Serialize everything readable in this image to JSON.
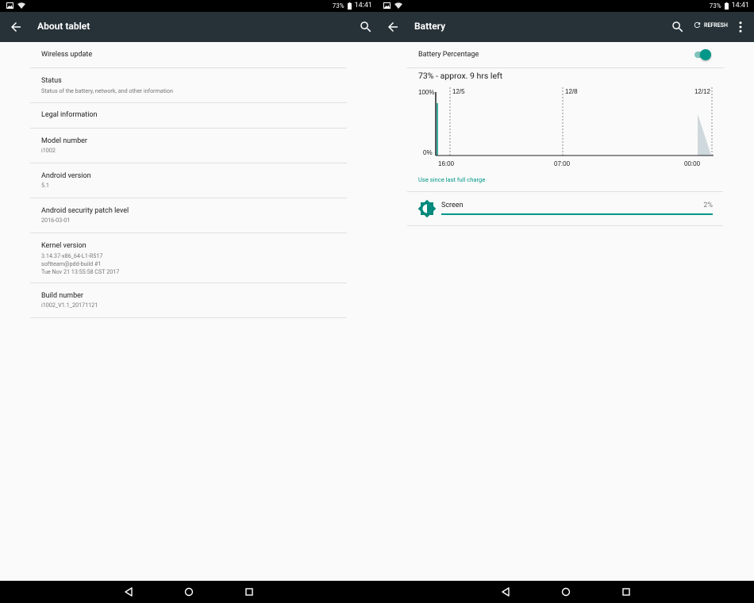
{
  "status_bar": {
    "battery": "73%",
    "time": "14:41"
  },
  "about": {
    "title": "About tablet",
    "items": [
      {
        "label": "Wireless update",
        "sub": []
      },
      {
        "label": "Status",
        "sub": [
          "Status of the battery, network, and other information"
        ]
      },
      {
        "label": "Legal information",
        "sub": []
      },
      {
        "label": "Model number",
        "sub": [
          "i1002"
        ]
      },
      {
        "label": "Android version",
        "sub": [
          "5.1"
        ]
      },
      {
        "label": "Android security patch level",
        "sub": [
          "2016-03-01"
        ]
      },
      {
        "label": "Kernel version",
        "sub": [
          "3.14.37-x86_64-L1-R517",
          "softteam@pdd-build #1",
          "Tue Nov 21 13:55:58 CST 2017"
        ]
      },
      {
        "label": "Build number",
        "sub": [
          "i1002_V1.1_20171121"
        ]
      }
    ]
  },
  "battery": {
    "title": "Battery",
    "refresh_label": "REFRESH",
    "percentage_label": "Battery Percentage",
    "percentage_toggle_on": true,
    "summary": "73% - approx. 9 hrs left",
    "use_since_label": "Use since last full charge",
    "app_usage": [
      {
        "name": "Screen",
        "percent": "2%",
        "fraction": 0.02
      }
    ],
    "colors": {
      "accent": "#009688",
      "appbar": "#263238",
      "predicted": "#cfd8dc"
    }
  },
  "chart_data": {
    "type": "line",
    "y_tick_labels": [
      "100%",
      "0%"
    ],
    "x_tick_labels": [
      "16:00",
      "07:00",
      "00:00"
    ],
    "date_markers": [
      "12/5",
      "12/8",
      "12/12"
    ],
    "ylim": [
      0,
      100
    ],
    "series": [
      {
        "values": [
          100,
          100,
          0
        ]
      }
    ],
    "grid": false
  }
}
